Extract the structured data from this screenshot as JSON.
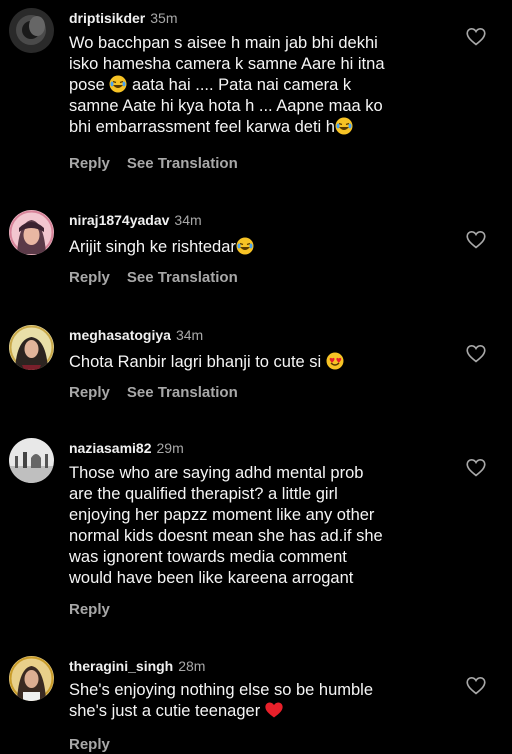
{
  "comments": [
    {
      "username": "driptisikder",
      "time": "35m",
      "text_parts": [
        "Wo bacchpan s aisee h main jab bhi dekhi\nisko hamesha camera k samne Aare hi itna\npose ",
        " aata hai .... Pata nai camera k\nsamne Aate hi kya hota h ... Aapne maa ko\nbhi embarrassment feel karwa deti h"
      ],
      "reply_label": "Reply",
      "translate_label": "See Translation"
    },
    {
      "username": "niraj1874yadav",
      "time": "34m",
      "text_parts": [
        "Arijit singh ke rishtedar"
      ],
      "reply_label": "Reply",
      "translate_label": "See Translation"
    },
    {
      "username": "meghasatogiya",
      "time": "34m",
      "text_parts": [
        "Chota Ranbir lagri bhanji to cute si "
      ],
      "reply_label": "Reply",
      "translate_label": "See Translation"
    },
    {
      "username": "naziasami82",
      "time": "29m",
      "text_parts": [
        "Those who are saying adhd mental prob\nare the qualified therapist?  a little girl\nenjoying her papzz moment  like any other\nnormal kids doesnt mean she has ad.if she\nwas ignorent  towards media comment\nwould have been like kareena arrogant"
      ],
      "reply_label": "Reply"
    },
    {
      "username": "theragini_singh",
      "time": "28m",
      "text_parts": [
        "She's enjoying nothing else so be humble\nshe's just a cutie teenager "
      ],
      "reply_label": "Reply"
    }
  ],
  "colors": {
    "background": "#000000",
    "text": "#f5f5f5",
    "secondary": "#a8a8a8",
    "heart_red": "#e8202a",
    "emoji_yellow": "#f7c325"
  }
}
